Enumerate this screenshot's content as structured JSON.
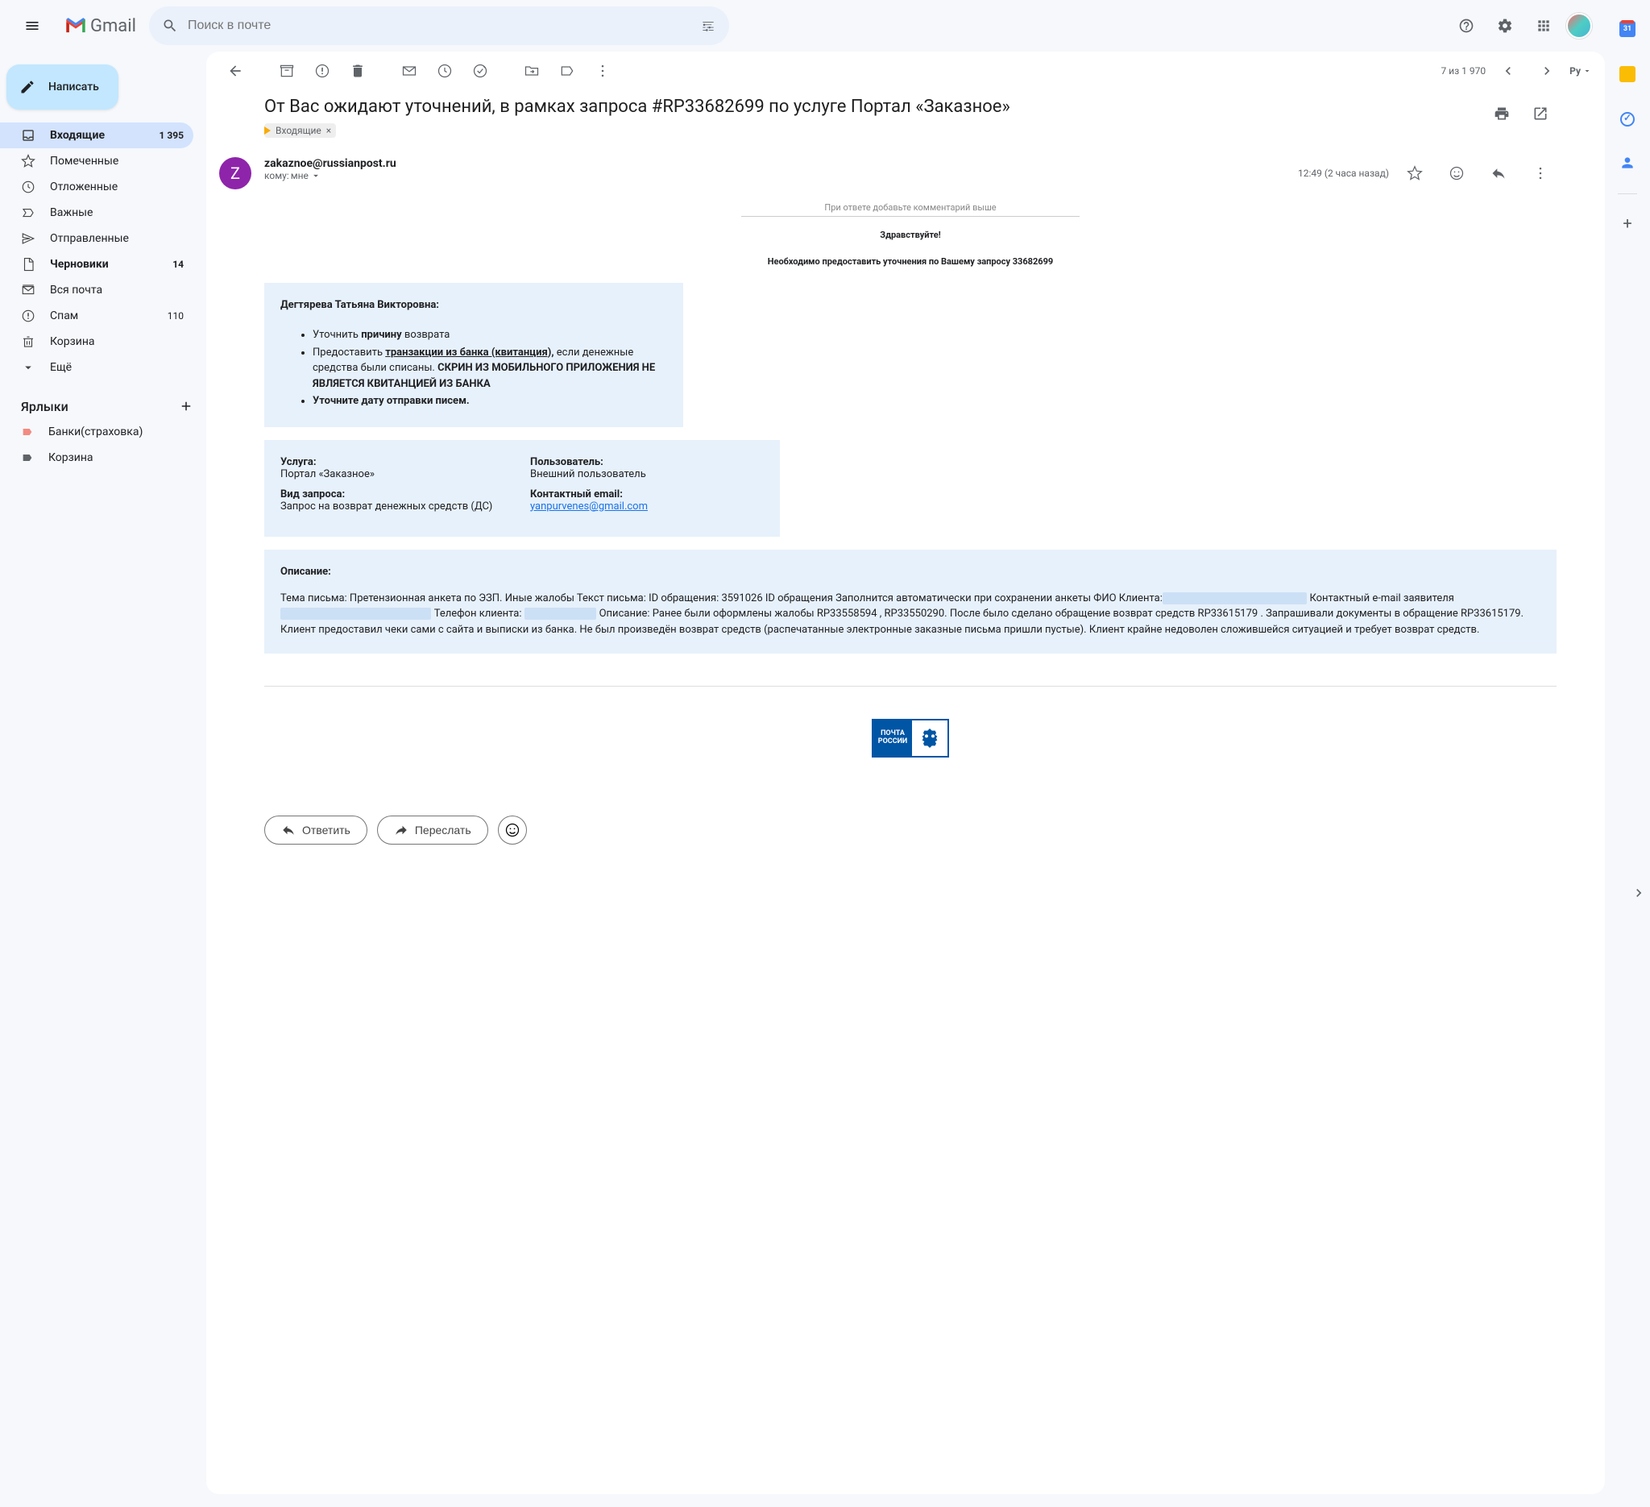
{
  "header": {
    "app_name": "Gmail",
    "search_placeholder": "Поиск в почте"
  },
  "compose_label": "Написать",
  "nav": [
    {
      "icon": "inbox",
      "label": "Входящие",
      "count": "1 395",
      "active": true,
      "bold": true
    },
    {
      "icon": "star",
      "label": "Помеченные"
    },
    {
      "icon": "clock",
      "label": "Отложенные"
    },
    {
      "icon": "important",
      "label": "Важные"
    },
    {
      "icon": "send",
      "label": "Отправленные"
    },
    {
      "icon": "draft",
      "label": "Черновики",
      "count": "14",
      "bold": true
    },
    {
      "icon": "mail",
      "label": "Вся почта"
    },
    {
      "icon": "spam",
      "label": "Спам",
      "count": "110"
    },
    {
      "icon": "trash",
      "label": "Корзина"
    },
    {
      "icon": "more",
      "label": "Ещё"
    }
  ],
  "labels_header": "Ярлыки",
  "labels": [
    {
      "label": "Банки(страховка)",
      "color": "#f28b82"
    },
    {
      "label": "Корзина",
      "color": "#5f6368"
    }
  ],
  "pagination": "7 из 1 970",
  "lang": "Py",
  "subject": "От Вас ожидают уточнений, в рамках запроса #RP33682699 по услуге Портал «Заказное»",
  "inbox_chip": "Входящие",
  "sender": {
    "initial": "Z",
    "email": "zakaznoe@russianpost.ru",
    "to_label": "кому:",
    "to_value": "мне"
  },
  "timestamp": "12:49 (2 часа назад)",
  "body": {
    "reply_hint": "При ответе добавьте комментарий выше",
    "greeting": "Здравствуйте!",
    "instruction": "Необходимо предоставить уточнения по Вашему запросу 33682699",
    "client_name": "Дегтярева Татьяна Викторовна:",
    "bullets": {
      "b1_a": "Уточнить ",
      "b1_b": "причину",
      "b1_c": " возврата",
      "b2_a": "Предоставить ",
      "b2_b": "транзакции из банка (квитанция),",
      "b2_c": " если денежные средства были списаны. ",
      "b2_d": "СКРИН ИЗ МОБИЛЬНОГО ПРИЛОЖЕНИЯ НЕ ЯВЛЯЕТСЯ КВИТАНЦИЕЙ ИЗ БАНКА",
      "b3": "Уточните дату отправки писем."
    },
    "info": {
      "service_label": "Услуга:",
      "service_value": "Портал «Заказное»",
      "type_label": "Вид запроса:",
      "type_value": "Запрос на возврат денежных средств (ДС)",
      "user_label": "Пользователь:",
      "user_value": "Внешний пользователь",
      "email_label": "Контактный email:",
      "email_value": "yanpurvenes@gmail.com"
    },
    "desc_label": "Описание:",
    "desc": {
      "p1": "Тема письма: Претензионная анкета по ЭЗП. Иные жалобы Текст письма: ID обращения: 3591026 ID обращения Заполнится автоматически при сохранении анкеты ФИО Клиента:",
      "p2": " Контактный e-mail заявителя ",
      "p3": " Телефон клиента: ",
      "p4": " Описание: Ранее были оформлены жалобы RP33558594 , RP33550290. После было сделано обращение возврат средств RP33615179 . Запрашивали документы в обращение RP33615179. Клиент предоставил чеки сами с сайта и выписки из банка. Не был произведён возврат средств (распечатанные электронные заказные письма пришли пустые). Клиент крайне недоволен сложившейся ситуацией и требует возврат средств."
    },
    "logo": {
      "line1": "ПОЧТА",
      "line2": "РОССИИ"
    }
  },
  "actions": {
    "reply": "Ответить",
    "forward": "Переслать"
  },
  "calendar_day": "31"
}
